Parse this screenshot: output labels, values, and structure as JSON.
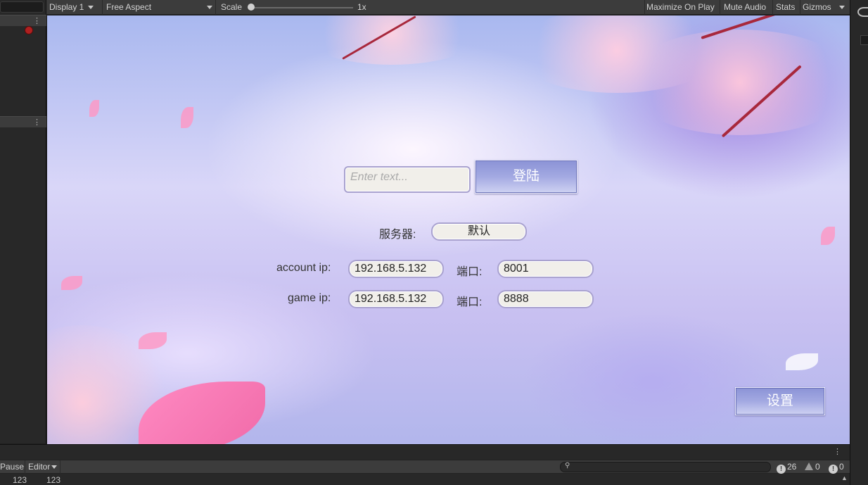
{
  "toolbar": {
    "display": "Display 1",
    "aspect": "Free Aspect",
    "scale_label": "Scale",
    "scale_value": "1x",
    "scale_level": 0.0,
    "maximize": "Maximize On Play",
    "mute": "Mute Audio",
    "stats": "Stats",
    "gizmos": "Gizmos"
  },
  "login": {
    "username_placeholder": "Enter text...",
    "username_value": "",
    "login_button": "登陆"
  },
  "server": {
    "label": "服务器:",
    "selected": "默认"
  },
  "account": {
    "label": "account ip:",
    "ip": "192.168.5.132",
    "port_label": "端口:",
    "port": "8001"
  },
  "game": {
    "label": "game ip:",
    "ip": "192.168.5.132",
    "port_label": "端口:",
    "port": "8888"
  },
  "settings_button": "设置",
  "console": {
    "pause": "Pause",
    "editor": "Editor",
    "error_count": "26",
    "warning_count": "0",
    "info_count": "0",
    "rows": [
      {
        "a": "123",
        "b": "123"
      }
    ]
  },
  "icons": {
    "kebab": "kebab-menu-icon",
    "bug": "bug-icon",
    "search": "search-icon",
    "error": "error-icon",
    "warning": "warning-icon",
    "info": "info-icon"
  },
  "colors": {
    "editor_bg": "#282828",
    "toolbar_bg": "#3c3c3c",
    "button_blue": "#8b93d6",
    "field_bg": "#f1efea",
    "field_border": "#a9a2cf"
  }
}
